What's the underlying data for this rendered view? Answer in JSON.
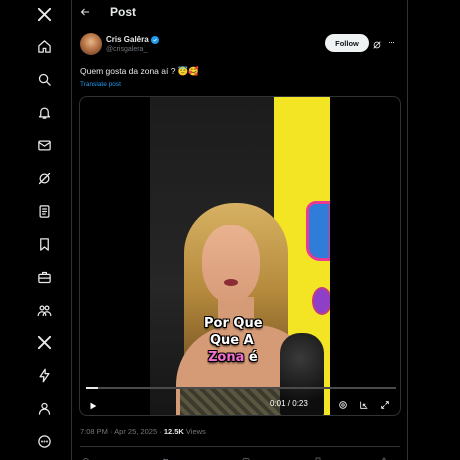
{
  "header": {
    "title": "Post"
  },
  "post": {
    "author_name": "Cris Galêra",
    "handle": "@crisgalera_",
    "follow_label": "Follow",
    "text": "Quem gosta da zona aí ? 😇🥰",
    "translate_label": "Translate post",
    "timestamp": "7:08 PM · Apr 25, 2025",
    "separator": " · ",
    "views_count": "12.5K",
    "views_label": " Views"
  },
  "video": {
    "caption_line1": "Por Que",
    "caption_line2": "Que A",
    "caption_highlight": "Zona",
    "caption_after": " é",
    "time": "0:01 / 0:23",
    "progress": 0.04
  },
  "colors": {
    "accent": "#1d9bf0",
    "caption_highlight": "#f06fd0",
    "background": "#000000"
  }
}
